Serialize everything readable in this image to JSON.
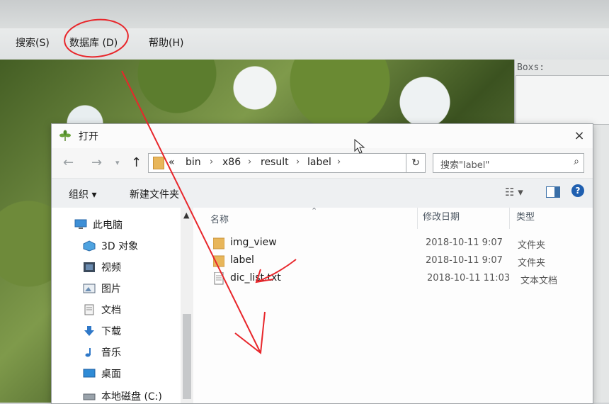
{
  "app": {
    "menu": [
      "搜索(S)",
      "数据库 (D)",
      "帮助(H)"
    ],
    "boxes_label": "Boxs:"
  },
  "dialog": {
    "title": "打开",
    "close": "×",
    "address": {
      "crumbs": [
        "«",
        "bin",
        "x86",
        "result",
        "label"
      ]
    },
    "search_placeholder": "搜索\"label\"",
    "toolbar": {
      "organize": "组织 ▾",
      "new_folder": "新建文件夹"
    },
    "nav_pane": [
      {
        "label": "此电脑",
        "icon": "computer-icon"
      },
      {
        "label": "3D 对象",
        "icon": "3d-objects-icon"
      },
      {
        "label": "视频",
        "icon": "video-icon"
      },
      {
        "label": "图片",
        "icon": "pictures-icon"
      },
      {
        "label": "文档",
        "icon": "documents-icon"
      },
      {
        "label": "下载",
        "icon": "download-icon"
      },
      {
        "label": "音乐",
        "icon": "music-icon"
      },
      {
        "label": "桌面",
        "icon": "desktop-icon"
      },
      {
        "label": "本地磁盘 (C:)",
        "icon": "disk-icon"
      }
    ],
    "columns": {
      "name": "名称",
      "date": "修改日期",
      "type": "类型"
    },
    "files": [
      {
        "name": "img_view",
        "date": "2018-10-11 9:07",
        "type": "文件夹",
        "icon": "folder-icon"
      },
      {
        "name": "label",
        "date": "2018-10-11 9:07",
        "type": "文件夹",
        "icon": "folder-icon"
      },
      {
        "name": "dic_list.txt",
        "date": "2018-10-11 11:03",
        "type": "文本文档",
        "icon": "text-file-icon"
      }
    ]
  },
  "colors": {
    "annotation": "#e8262b",
    "folder": "#e8b65a",
    "accent": "#1f5fb0"
  }
}
